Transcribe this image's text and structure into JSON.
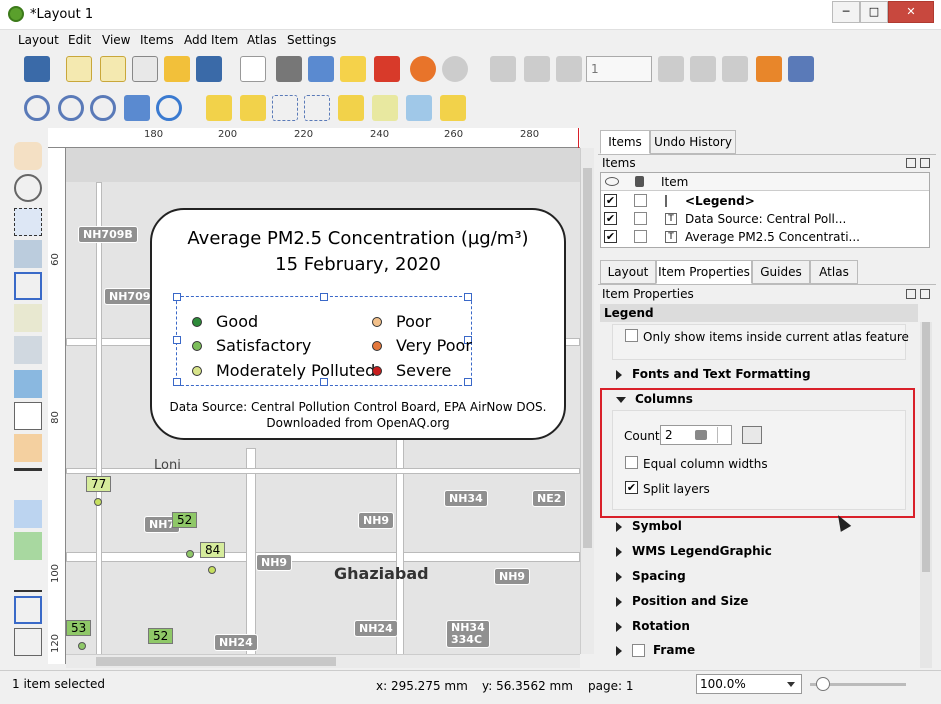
{
  "window": {
    "title": "*Layout 1",
    "min": "─",
    "max": "□",
    "close": "✕"
  },
  "menu": [
    "Layout",
    "Edit",
    "View",
    "Items",
    "Add Item",
    "Atlas",
    "Settings"
  ],
  "toolbar": {
    "page_value": "1"
  },
  "ruler": {
    "h": [
      "180",
      "200",
      "220",
      "240",
      "260",
      "280"
    ],
    "v": [
      "60",
      "80",
      "100",
      "120"
    ]
  },
  "map": {
    "places": [
      "Loni",
      "Ghaziabad"
    ],
    "shields": [
      "NH709B",
      "NH709",
      "NH7",
      "NH9",
      "NH9",
      "NH9",
      "NH24",
      "NH24",
      "NH34",
      "NE2",
      "NH34 334C"
    ],
    "markers": [
      {
        "label": "77",
        "color": "#d6ec9c"
      },
      {
        "label": "52",
        "color": "#8fc868"
      },
      {
        "label": "84",
        "color": "#d6ec9c"
      },
      {
        "label": "53",
        "color": "#8fc868"
      },
      {
        "label": "52",
        "color": "#8fc868"
      }
    ]
  },
  "legend": {
    "title1": "Average PM2.5 Concentration (µg/m³)",
    "title2": "15 February, 2020",
    "items": [
      {
        "label": "Good",
        "color": "#2e8b3a"
      },
      {
        "label": "Satisfactory",
        "color": "#7cbe5a"
      },
      {
        "label": "Moderately Polluted",
        "color": "#d8e48a"
      },
      {
        "label": "Poor",
        "color": "#f2c08a"
      },
      {
        "label": "Very Poor",
        "color": "#e4783c"
      },
      {
        "label": "Severe",
        "color": "#c81e1e"
      }
    ],
    "source1": "Data Source: Central Pollution Control Board, EPA AirNow DOS.",
    "source2": "Downloaded from OpenAQ.org"
  },
  "panel": {
    "tabs_top": [
      "Items",
      "Undo History"
    ],
    "items_label": "Items",
    "items_header": "Item",
    "items": [
      "<Legend>",
      "Data Source: Central Poll...",
      "Average PM2.5 Concentrati..."
    ],
    "tabs_mid": [
      "Layout",
      "Item Properties",
      "Guides",
      "Atlas"
    ],
    "props_label": "Item Properties",
    "section": "Legend",
    "atlas_check": "Only show items inside current atlas feature",
    "fonts": "Fonts and Text Formatting",
    "columns": "Columns",
    "count_label": "Count",
    "count_value": "2",
    "equal_widths": "Equal column widths",
    "split_layers": "Split layers",
    "symbol": "Symbol",
    "wms": "WMS LegendGraphic",
    "spacing": "Spacing",
    "position": "Position and Size",
    "rotation": "Rotation",
    "frame": "Frame"
  },
  "status": {
    "selected": "1 item selected",
    "x": "x: 295.275 mm",
    "y": "y: 56.3562 mm",
    "page": "page: 1",
    "zoom": "100.0%"
  },
  "colors": {
    "highlight": "#d9202a",
    "handle": "#3a68c8"
  }
}
